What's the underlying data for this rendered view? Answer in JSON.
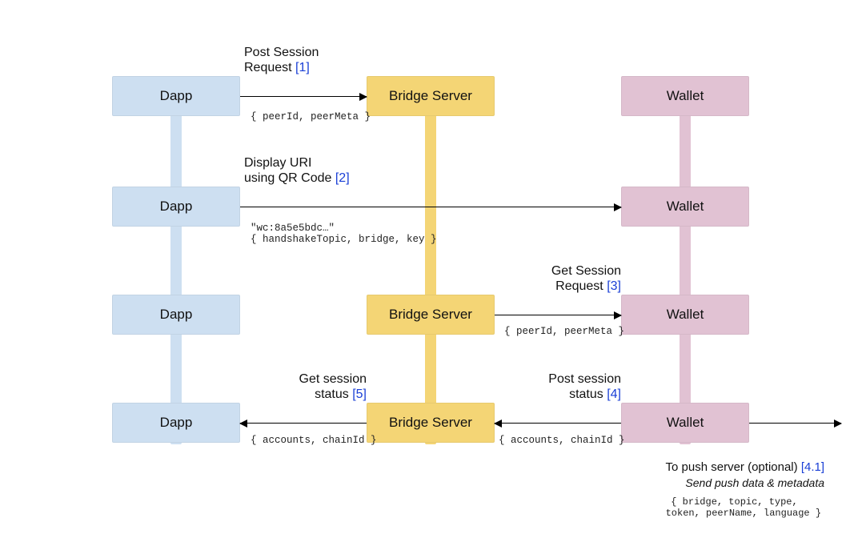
{
  "columns": {
    "dapp": "Dapp",
    "bridge": "Bridge Server",
    "wallet": "Wallet"
  },
  "steps": [
    {
      "label": "Post Session\nRequest",
      "num": "[1]",
      "payload": "{ peerId, peerMeta }",
      "from": "dapp",
      "to": "bridge"
    },
    {
      "label": "Display URI\nusing QR Code",
      "num": "[2]",
      "payload": "\"wc:8a5e5bdc…\"\n{ handshakeTopic, bridge, key }",
      "from": "dapp",
      "to": "wallet"
    },
    {
      "label": "Get Session\nRequest",
      "num": "[3]",
      "payload": "{ peerId, peerMeta }",
      "from": "bridge",
      "to": "wallet"
    },
    {
      "label": "Post session\nstatus",
      "num": "[4]",
      "payload": "{ accounts, chainId }",
      "from": "wallet",
      "to": "bridge"
    },
    {
      "label": "Get session\nstatus",
      "num": "[5]",
      "payload": "{ accounts, chainId }",
      "from": "bridge",
      "to": "dapp"
    }
  ],
  "optional": {
    "title": "To push server (optional)",
    "num": "[4.1]",
    "subtitle": "Send push data & metadata",
    "payload": "{ bridge, topic, type,\n   token, peerName, language }"
  }
}
